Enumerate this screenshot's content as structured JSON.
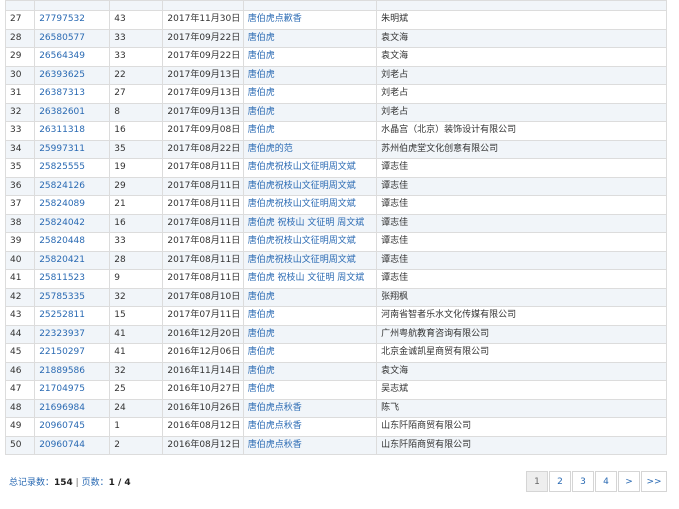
{
  "table": {
    "rows": [
      {
        "no": "27",
        "reg": "27797532",
        "cls": "43",
        "date": "2017年11月30日",
        "mark": "唐伯虎点歉香",
        "applicant": "朱明斌"
      },
      {
        "no": "28",
        "reg": "26580577",
        "cls": "33",
        "date": "2017年09月22日",
        "mark": "唐伯虎",
        "applicant": "袁文海"
      },
      {
        "no": "29",
        "reg": "26564349",
        "cls": "33",
        "date": "2017年09月22日",
        "mark": "唐伯虎",
        "applicant": "袁文海"
      },
      {
        "no": "30",
        "reg": "26393625",
        "cls": "22",
        "date": "2017年09月13日",
        "mark": "唐伯虎",
        "applicant": "刘老占"
      },
      {
        "no": "31",
        "reg": "26387313",
        "cls": "27",
        "date": "2017年09月13日",
        "mark": "唐伯虎",
        "applicant": "刘老占"
      },
      {
        "no": "32",
        "reg": "26382601",
        "cls": "8",
        "date": "2017年09月13日",
        "mark": "唐伯虎",
        "applicant": "刘老占"
      },
      {
        "no": "33",
        "reg": "26311318",
        "cls": "16",
        "date": "2017年09月08日",
        "mark": "唐伯虎",
        "applicant": "水晶宫（北京）装饰设计有限公司"
      },
      {
        "no": "34",
        "reg": "25997311",
        "cls": "35",
        "date": "2017年08月22日",
        "mark": "唐伯虎的范",
        "applicant": "苏州伯虎堂文化创意有限公司"
      },
      {
        "no": "35",
        "reg": "25825555",
        "cls": "19",
        "date": "2017年08月11日",
        "mark": "唐伯虎祝枝山文征明周文斌",
        "applicant": "谭志佳"
      },
      {
        "no": "36",
        "reg": "25824126",
        "cls": "29",
        "date": "2017年08月11日",
        "mark": "唐伯虎祝枝山文征明周文斌",
        "applicant": "谭志佳"
      },
      {
        "no": "37",
        "reg": "25824089",
        "cls": "21",
        "date": "2017年08月11日",
        "mark": "唐伯虎祝枝山文征明周文斌",
        "applicant": "谭志佳"
      },
      {
        "no": "38",
        "reg": "25824042",
        "cls": "16",
        "date": "2017年08月11日",
        "mark": "唐伯虎 祝枝山 文征明 周文斌",
        "applicant": "谭志佳"
      },
      {
        "no": "39",
        "reg": "25820448",
        "cls": "33",
        "date": "2017年08月11日",
        "mark": "唐伯虎祝枝山文征明周文斌",
        "applicant": "谭志佳"
      },
      {
        "no": "40",
        "reg": "25820421",
        "cls": "28",
        "date": "2017年08月11日",
        "mark": "唐伯虎祝枝山文征明周文斌",
        "applicant": "谭志佳"
      },
      {
        "no": "41",
        "reg": "25811523",
        "cls": "9",
        "date": "2017年08月11日",
        "mark": "唐伯虎 祝枝山 文征明 周文斌",
        "applicant": "谭志佳"
      },
      {
        "no": "42",
        "reg": "25785335",
        "cls": "32",
        "date": "2017年08月10日",
        "mark": "唐伯虎",
        "applicant": "张翔枫"
      },
      {
        "no": "43",
        "reg": "25252811",
        "cls": "15",
        "date": "2017年07月11日",
        "mark": "唐伯虎",
        "applicant": "河南省智者乐水文化传媒有限公司"
      },
      {
        "no": "44",
        "reg": "22323937",
        "cls": "41",
        "date": "2016年12月20日",
        "mark": "唐伯虎",
        "applicant": "广州粤航教育咨询有限公司"
      },
      {
        "no": "45",
        "reg": "22150297",
        "cls": "41",
        "date": "2016年12月06日",
        "mark": "唐伯虎",
        "applicant": "北京金诚凯星商贸有限公司"
      },
      {
        "no": "46",
        "reg": "21889586",
        "cls": "32",
        "date": "2016年11月14日",
        "mark": "唐伯虎",
        "applicant": "袁文海"
      },
      {
        "no": "47",
        "reg": "21704975",
        "cls": "25",
        "date": "2016年10月27日",
        "mark": "唐伯虎",
        "applicant": "吴志斌"
      },
      {
        "no": "48",
        "reg": "21696984",
        "cls": "24",
        "date": "2016年10月26日",
        "mark": "唐伯虎点秋香",
        "applicant": "陈飞"
      },
      {
        "no": "49",
        "reg": "20960745",
        "cls": "1",
        "date": "2016年08月12日",
        "mark": "唐伯虎点秋香",
        "applicant": "山东阡陌商贸有限公司"
      },
      {
        "no": "50",
        "reg": "20960744",
        "cls": "2",
        "date": "2016年08月12日",
        "mark": "唐伯虎点秋香",
        "applicant": "山东阡陌商贸有限公司"
      }
    ]
  },
  "footer": {
    "total_label": "总记录数：",
    "total_value": "154",
    "separator": " | ",
    "pages_label": "页数：",
    "pages_value": "1 / 4"
  },
  "pager": {
    "buttons": [
      "1",
      "2",
      "3",
      "4",
      ">",
      ">>"
    ],
    "active_page": "1"
  },
  "colors": {
    "link": "#2a6ab3",
    "row_alt": "#f1f5f9",
    "border": "#dcdcdc"
  }
}
